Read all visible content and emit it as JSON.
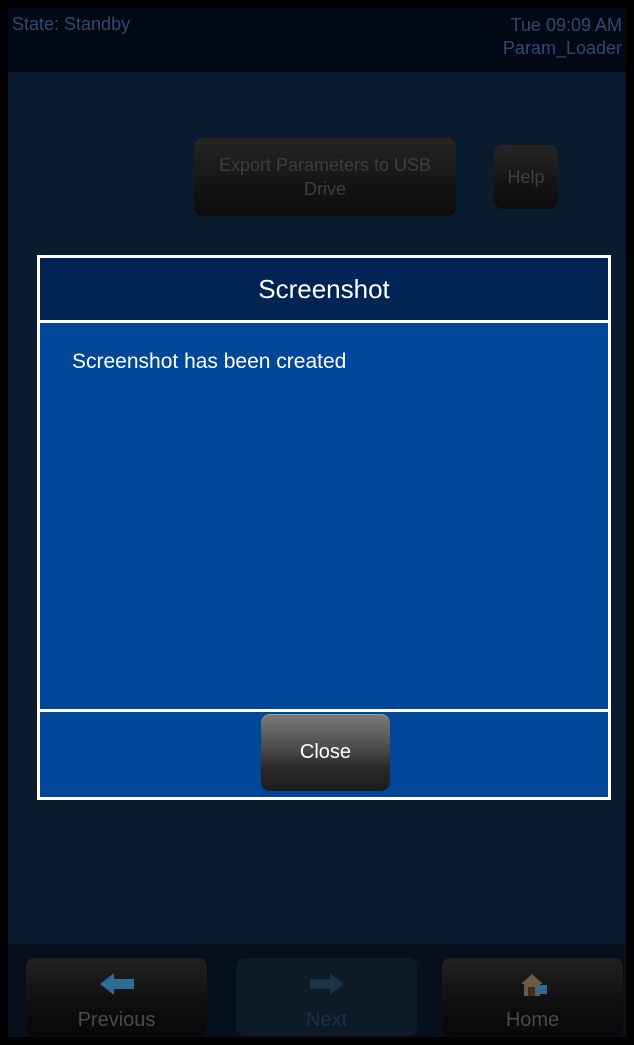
{
  "header": {
    "state": "State: Standby",
    "datetime": "Tue 09:09 AM",
    "screen_name": "Param_Loader"
  },
  "main": {
    "export_button": "Export Parameters to USB Drive",
    "help_button": "Help"
  },
  "modal": {
    "title": "Screenshot",
    "message": "Screenshot has been created",
    "close_button": "Close"
  },
  "footer": {
    "previous": "Previous",
    "next": "Next",
    "home": "Home"
  },
  "colors": {
    "modal_title_bg": "#002554",
    "modal_body_bg": "#00479a",
    "background": "#0b1b2e"
  },
  "icons": {
    "previous": "arrow-left-icon",
    "next": "arrow-right-icon",
    "home": "home-icon"
  }
}
